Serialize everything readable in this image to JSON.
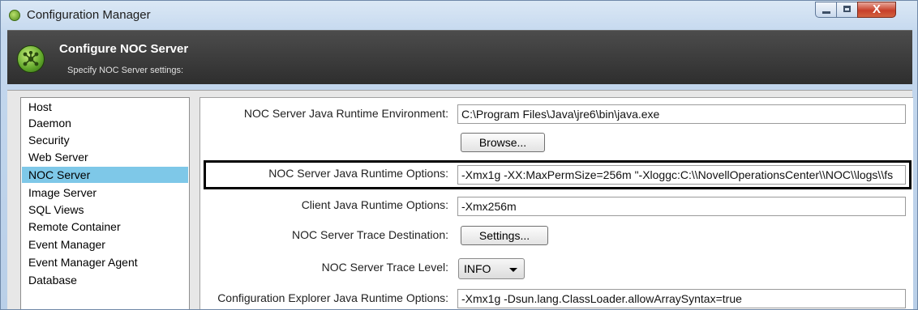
{
  "window": {
    "title": "Configuration Manager",
    "close_glyph": "X"
  },
  "header": {
    "title": "Configure NOC Server",
    "subtitle": "Specify NOC Server settings:"
  },
  "sidebar": {
    "items": [
      {
        "label": "Host"
      },
      {
        "label": "Daemon"
      },
      {
        "label": "Security"
      },
      {
        "label": "Web Server"
      },
      {
        "label": "NOC Server",
        "selected": true
      },
      {
        "label": "Image Server"
      },
      {
        "label": "SQL Views"
      },
      {
        "label": "Remote Container"
      },
      {
        "label": "Event Manager"
      },
      {
        "label": "Event Manager Agent"
      },
      {
        "label": "Database"
      }
    ]
  },
  "settings": {
    "jre_label": "NOC Server Java Runtime Environment:",
    "jre_value": "C:\\Program Files\\Java\\jre6\\bin\\java.exe",
    "browse_label": "Browse...",
    "jro_label": "NOC Server Java Runtime Options:",
    "jro_value": "-Xmx1g -XX:MaxPermSize=256m \"-Xloggc:C:\\\\NovellOperationsCenter\\\\NOC\\\\logs\\\\fs",
    "client_label": "Client Java Runtime Options:",
    "client_value": "-Xmx256m",
    "trace_dest_label": "NOC Server Trace Destination:",
    "settings_button": "Settings...",
    "trace_level_label": "NOC Server Trace Level:",
    "trace_level_value": "INFO",
    "explorer_label": "Configuration Explorer Java Runtime Options:",
    "explorer_value": "-Xmx1g -Dsun.lang.ClassLoader.allowArraySyntax=true"
  },
  "colors": {
    "selection": "#7ec8e8",
    "header_bg": "#3a3a3a",
    "highlight_border": "#000000"
  }
}
